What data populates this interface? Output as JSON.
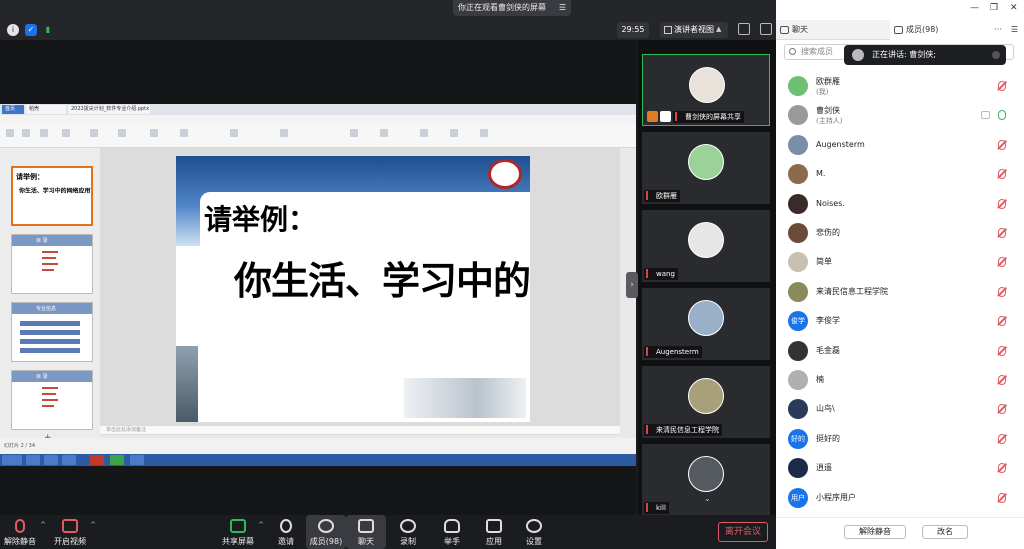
{
  "topbar": {
    "share_notice": "你正在观看曹剑侠的屏幕",
    "timer": "29:55",
    "view_button": "演讲者视图"
  },
  "ppt": {
    "tabs": [
      "首页",
      "稻壳",
      "2022拔尖计划_软件专业介绍.pptx"
    ],
    "slide": {
      "title": "请举例：",
      "subtitle": "你生活、学习中的网络应用？"
    },
    "thumb_titles": [
      "请举例：",
      "目 录",
      "专业信息",
      "目 录"
    ],
    "thumb_sub": "你生活、学习中的网络应用？",
    "notes_placeholder": "单击此处添加备注",
    "status": "幻灯片 2 / 34"
  },
  "gallery": {
    "tiles": [
      {
        "name": "曹剑侠的屏幕共享"
      },
      {
        "name": "欧群雁"
      },
      {
        "name": "wang"
      },
      {
        "name": "Augensterm"
      },
      {
        "name": "来清民信息工程学院"
      },
      {
        "name": "kill"
      }
    ]
  },
  "panel": {
    "tab_chat": "聊天",
    "tab_members": "成员(98)",
    "search_placeholder": "搜索成员",
    "speaking": "正在讲话: 曹剑侠;",
    "members": [
      {
        "name": "欧群雁",
        "sub": "(我)",
        "avatar": "",
        "color": "#6fbf73",
        "mic_on": false
      },
      {
        "name": "曹剑侠",
        "sub": "(主持人)",
        "avatar": "",
        "color": "#9a9a9a",
        "mic_on": true
      },
      {
        "name": "Augensterm",
        "sub": "",
        "avatar": "",
        "color": "#7a8ea8",
        "mic_on": false
      },
      {
        "name": "M.",
        "sub": "",
        "avatar": "",
        "color": "#8b6b4a",
        "mic_on": false
      },
      {
        "name": "Noises.",
        "sub": "",
        "avatar": "",
        "color": "#3a2a2a",
        "mic_on": false
      },
      {
        "name": "悲伤的",
        "sub": "",
        "avatar": "",
        "color": "#6b4a3a",
        "mic_on": false
      },
      {
        "name": "简单",
        "sub": "",
        "avatar": "",
        "color": "#c8c0b0",
        "mic_on": false
      },
      {
        "name": "来清民信息工程学院",
        "sub": "",
        "avatar": "",
        "color": "#8a8a5a",
        "mic_on": false
      },
      {
        "name": "李俊学",
        "sub": "",
        "avatar": "俊学",
        "color": "#1a73e8",
        "mic_on": false
      },
      {
        "name": "毛金磊",
        "sub": "",
        "avatar": "",
        "color": "#333333",
        "mic_on": false
      },
      {
        "name": "楠",
        "sub": "",
        "avatar": "",
        "color": "#b0b0b0",
        "mic_on": false
      },
      {
        "name": "山鸟\\",
        "sub": "",
        "avatar": "",
        "color": "#2a3a5a",
        "mic_on": false
      },
      {
        "name": "挺好的",
        "sub": "",
        "avatar": "好的",
        "color": "#1a73e8",
        "mic_on": false
      },
      {
        "name": "逍遥",
        "sub": "",
        "avatar": "",
        "color": "#1e2a4a",
        "mic_on": false
      },
      {
        "name": "小程序用户",
        "sub": "",
        "avatar": "用户",
        "color": "#1a73e8",
        "mic_on": false
      }
    ],
    "btn_unmute_all": "解除静音",
    "btn_rename": "改名"
  },
  "bottombar": {
    "unmute": "解除静音",
    "video": "开启视频",
    "share": "共享屏幕",
    "invite": "邀请",
    "members": "成员(98)",
    "chat": "聊天",
    "record": "录制",
    "raise_hand": "举手",
    "apps": "应用",
    "settings": "设置",
    "leave": "离开会议"
  }
}
